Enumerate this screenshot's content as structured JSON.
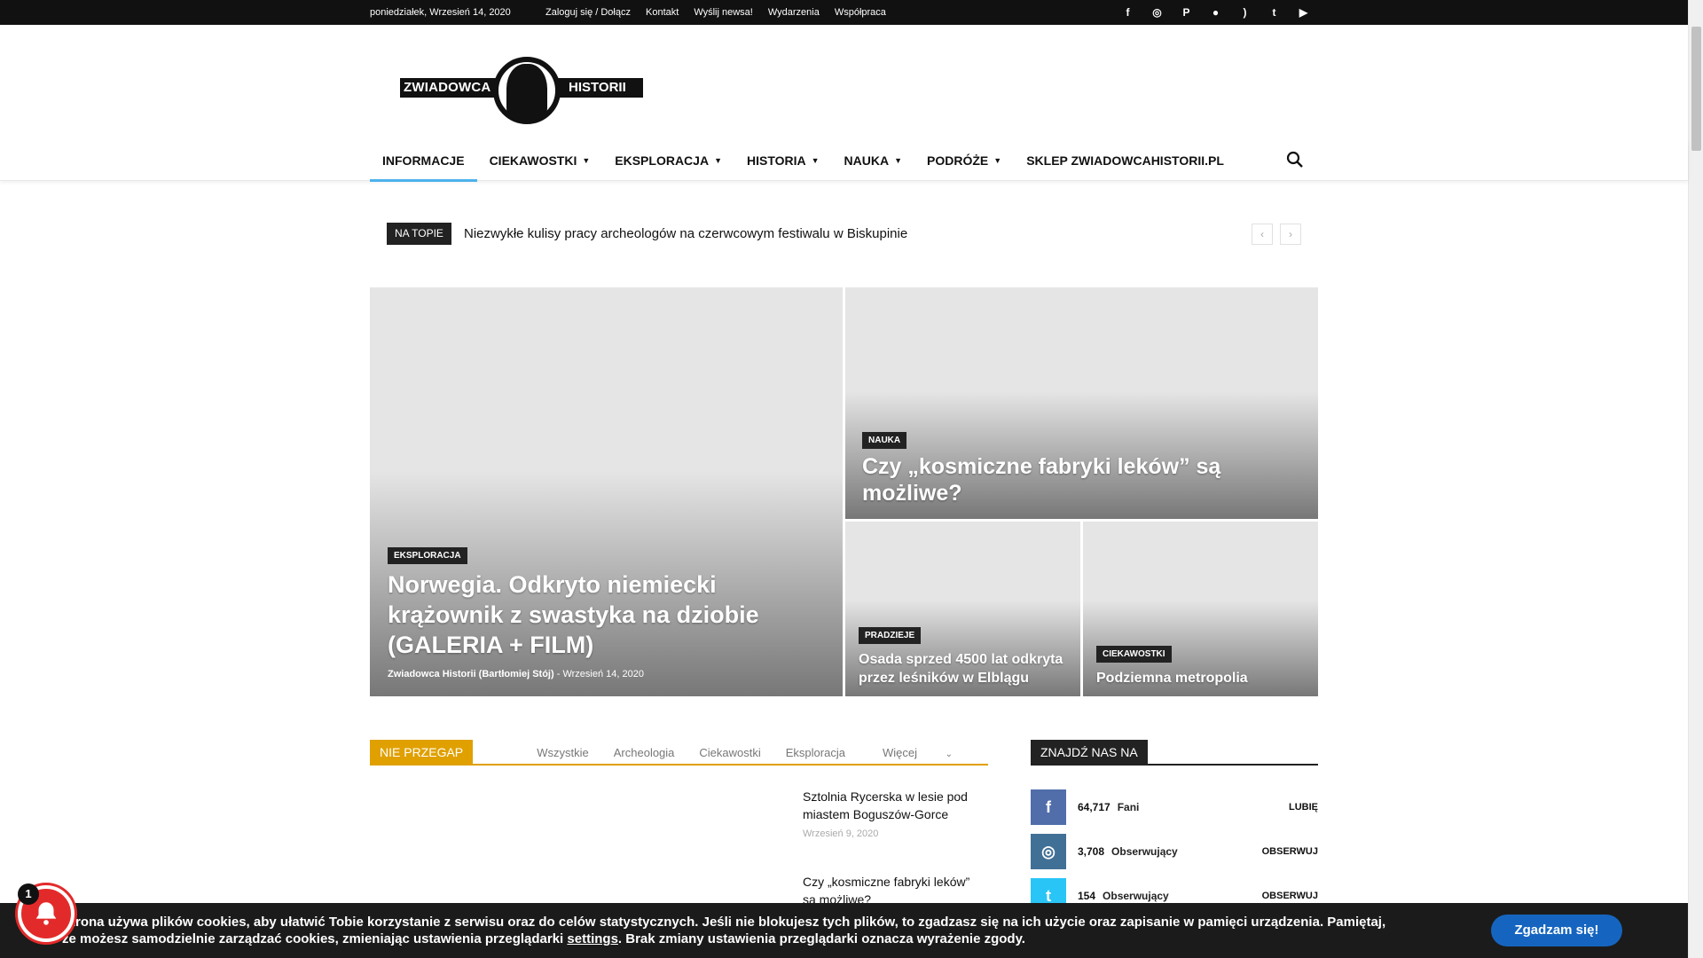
{
  "topbar": {
    "date": "poniedziałek, Wrzesień 14, 2020",
    "links": [
      "Zaloguj się / Dołącz",
      "Kontakt",
      "Wyślij newsa!",
      "Wydarzenia",
      "Współpraca"
    ],
    "social_icons": [
      "facebook-icon",
      "instagram-icon",
      "pinterest-icon",
      "reddit-icon",
      "rss-icon",
      "twitter-icon",
      "youtube-icon"
    ]
  },
  "logo": {
    "left": "ZWIADOWCA",
    "right": "HISTORII"
  },
  "nav": {
    "items": [
      "INFORMACJE",
      "CIEKAWOSTKI",
      "EKSPLORACJA",
      "HISTORIA",
      "NAUKA",
      "PODRÓŻE",
      "SKLEP ZWIADOWCAHISTORII.PL"
    ],
    "accent_color": "#4db2ec"
  },
  "ticker": {
    "badge": "NA TOPIE",
    "text": "Niezwykłe kulisy pracy archeologów na czerwcowym festiwalu w Biskupinie",
    "prev": "‹",
    "next": "›"
  },
  "featured": {
    "main": {
      "category": "EKSPLORACJA",
      "title": "Norwegia. Odkryto niemiecki krążownik z swastyka na dziobie (GALERIA + FILM)",
      "author": "Zwiadowca Historii (Bartłomiej Stój)",
      "separator": "-",
      "date": "Wrzesień 14, 2020"
    },
    "top_right": {
      "category": "NAUKA",
      "title": "Czy „kosmiczne fabryki leków” są możliwe?"
    },
    "bottom_left": {
      "category": "PRADZIEJE",
      "title": "Osada sprzed 4500 lat odkryta przez leśników w Elblągu"
    },
    "bottom_right": {
      "category": "CIEKAWOSTKI",
      "title": "Podziemna metropolia"
    }
  },
  "nie_przegap": {
    "label": "NIE PRZEGAP",
    "tabs": [
      "Wszystkie",
      "Archeologia",
      "Ciekawostki",
      "Eksploracja",
      "Więcej"
    ],
    "accent_color": "#e0a000",
    "posts": [
      {
        "title": "Sztolnia Rycerska w lesie pod miastem Boguszów-Gorce",
        "date": "Wrzesień 9, 2020"
      },
      {
        "title": "Czy „kosmiczne fabryki leków” są możliwe?",
        "date": ""
      }
    ]
  },
  "sidebar": {
    "label": "ZNAJDŹ NAS NA",
    "rows": [
      {
        "icon": "facebook-icon",
        "glyph": "f",
        "count": "64,717",
        "label": "Fani",
        "action": "LUBIĘ",
        "color": "#516eab"
      },
      {
        "icon": "instagram-icon",
        "glyph": "◎",
        "count": "3,708",
        "label": "Obserwujący",
        "action": "OBSERWUJ",
        "color": "#417096"
      },
      {
        "icon": "twitter-icon",
        "glyph": "t",
        "count": "154",
        "label": "Obserwujący",
        "action": "OBSERWUJ",
        "color": "#29c5f6"
      }
    ]
  },
  "cookie": {
    "text_before": "Strona używa plików cookies, aby ułatwić Tobie korzystanie z serwisu oraz do celów statystycznych. Jeśli nie blokujesz tych plików, to zgadzasz się na ich użycie oraz zapisanie w pamięci urządzenia. Pamiętaj, że możesz samodzielnie zarządzać cookies, zmieniając ustawienia przeglądarki",
    "link": "settings",
    "text_after": ". Brak zmiany ustawienia przeglądarki oznacza wyrażenie zgody.",
    "button": "Zgadzam się!",
    "button_color": "#1565c0"
  },
  "notification": {
    "count": "1",
    "color": "#e32a2a"
  }
}
